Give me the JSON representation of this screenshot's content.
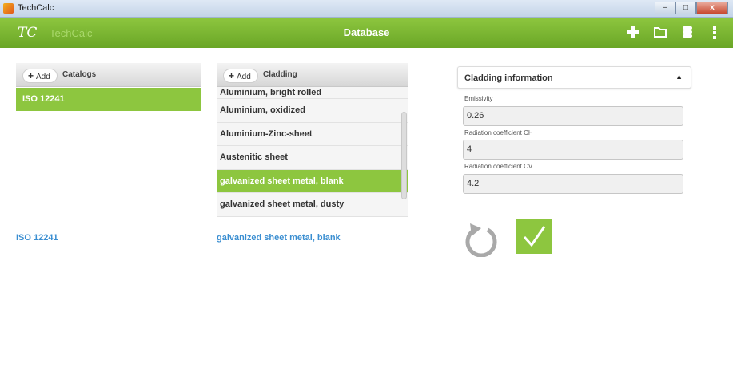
{
  "window": {
    "title": "TechCalc",
    "minimize": "–",
    "maximize": "□",
    "close": "x"
  },
  "appbar": {
    "logo": "TC",
    "logo_name": "TechCalc",
    "title": "Database",
    "actions": [
      "add-icon",
      "folder-icon",
      "database-icon",
      "more-vert-icon"
    ]
  },
  "catalogs": {
    "add_label": "Add",
    "header": "Catalogs",
    "items": [
      {
        "label": "ISO 12241",
        "selected": true
      }
    ],
    "selected_summary": "ISO 12241"
  },
  "cladding": {
    "add_label": "Add",
    "header": "Cladding",
    "items": [
      {
        "label": "Aluminium, bright rolled"
      },
      {
        "label": "Aluminium, oxidized"
      },
      {
        "label": "Aluminium-Zinc-sheet"
      },
      {
        "label": "Austenitic sheet"
      },
      {
        "label": "galvanized sheet metal, blank",
        "selected": true
      },
      {
        "label": "galvanized sheet metal, dusty"
      }
    ],
    "selected_summary": "galvanized sheet metal, blank"
  },
  "info": {
    "header": "Cladding information",
    "fields": [
      {
        "label": "Emissivity",
        "value": "0.26"
      },
      {
        "label": "Radiation coefficient CH",
        "value": "4"
      },
      {
        "label": "Radiation coefficient CV",
        "value": "4.2"
      }
    ]
  },
  "colors": {
    "accent": "#8dc63f",
    "link": "#3a8ed1"
  }
}
